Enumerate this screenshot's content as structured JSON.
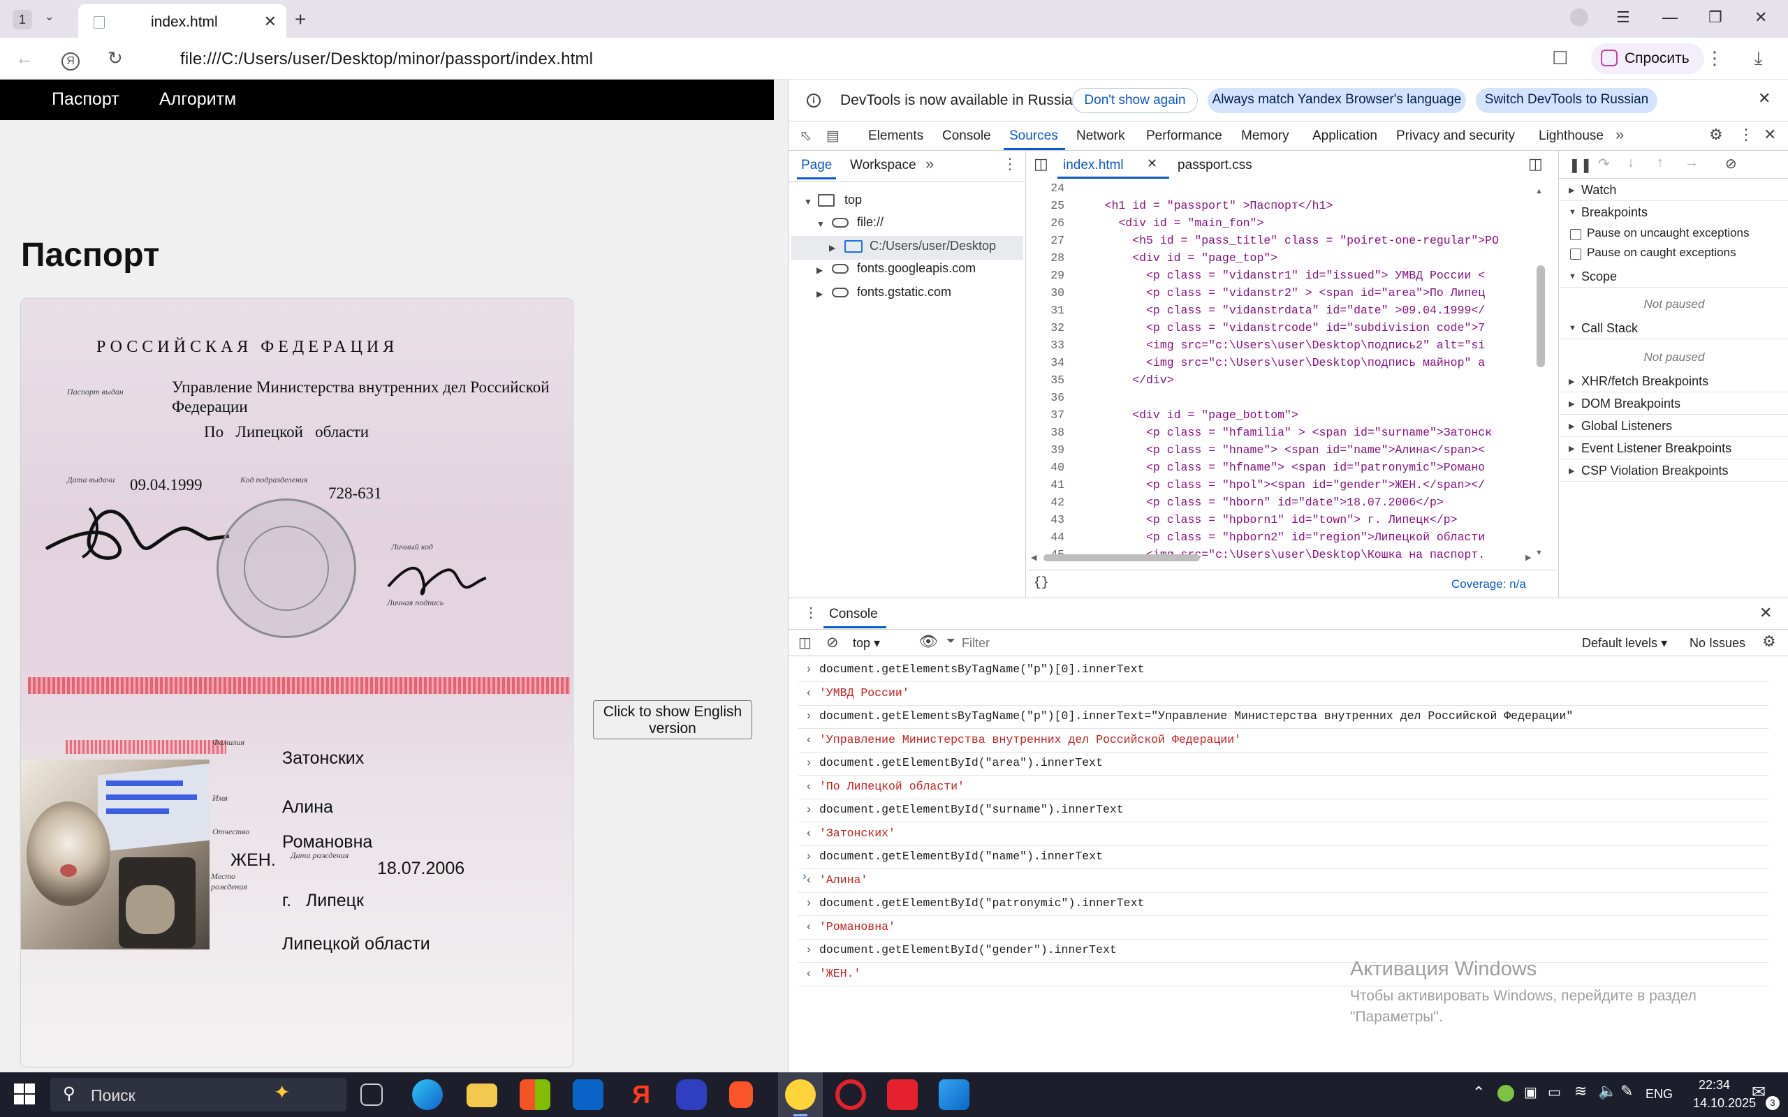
{
  "browser": {
    "tab_count": "1",
    "tab_title": "index.html",
    "url": "file:///C:/Users/user/Desktop/minor/passport/index.html",
    "ask_label": "Спросить"
  },
  "page": {
    "nav": [
      "Паспорт",
      "Алгоритм"
    ],
    "heading": "Паспорт",
    "passport": {
      "country": "РОССИЙСКАЯ   ФЕДЕРАЦИЯ",
      "issued_label": "Паспорт выдан",
      "issued_line1": "Управление Министерства внутренних дел Российской",
      "issued_line2": "Федерации",
      "area": "По   Липецкой   области",
      "date_label": "Дата выдачи",
      "date": "09.04.1999",
      "code_label": "Код подразделения",
      "code": "728-631",
      "personal_code_label": "Личный код",
      "personal_sign_label": "Личная подпись",
      "surname_label": "Фамилия",
      "surname": "Затонских",
      "name_label": "Имя",
      "name": "Алина",
      "patronymic_label": "Отчество",
      "patronymic": "Романовна",
      "gender": "ЖЕН.",
      "birth_label": "Дата рождения",
      "birth_date": "18.07.2006",
      "place_label": "Место рождения",
      "town": "г.   Липецк",
      "region": "Липецкой области"
    },
    "english_button": "Click to show English version"
  },
  "devtools": {
    "info": {
      "text": "DevTools is now available in Russian",
      "dont_show": "Don't show again",
      "match_language": "Always match Yandex Browser's language",
      "switch_russian": "Switch DevTools to Russian"
    },
    "tabs": [
      "Elements",
      "Console",
      "Sources",
      "Network",
      "Performance",
      "Memory",
      "Application",
      "Privacy and security",
      "Lighthouse"
    ],
    "active_tab": "Sources",
    "nav_subtabs": [
      "Page",
      "Workspace"
    ],
    "tree": [
      "top",
      "file://",
      "C:/Users/user/Desktop",
      "fonts.googleapis.com",
      "fonts.gstatic.com"
    ],
    "file_tabs": [
      "index.html",
      "passport.css"
    ],
    "code_lines": [
      {
        "n": "24",
        "code": ""
      },
      {
        "n": "25",
        "code": "    <h1 id = \"passport\" >Паспорт</h1>"
      },
      {
        "n": "26",
        "code": "      <div id = \"main_fon\">"
      },
      {
        "n": "27",
        "code": "        <h5 id = \"pass_title\" class = \"poiret-one-regular\">РО"
      },
      {
        "n": "28",
        "code": "        <div id = \"page_top\">"
      },
      {
        "n": "29",
        "code": "          <p class = \"vidanstr1\" id=\"issued\"> УМВД России <"
      },
      {
        "n": "30",
        "code": "          <p class = \"vidanstr2\" > <span id=\"area\">По Липец"
      },
      {
        "n": "31",
        "code": "          <p class = \"vidanstrdata\" id=\"date\" >09.04.1999</"
      },
      {
        "n": "32",
        "code": "          <p class = \"vidanstrcode\" id=\"subdivision code\">7"
      },
      {
        "n": "33",
        "code": "          <img src=\"c:\\Users\\user\\Desktop\\подпись2\" alt=\"si"
      },
      {
        "n": "34",
        "code": "          <img src=\"c:\\Users\\user\\Desktop\\подпись майнор\" a"
      },
      {
        "n": "35",
        "code": "        </div>"
      },
      {
        "n": "36",
        "code": ""
      },
      {
        "n": "37",
        "code": "        <div id = \"page_bottom\">"
      },
      {
        "n": "38",
        "code": "          <p class = \"hfamilia\" > <span id=\"surname\">Затонск"
      },
      {
        "n": "39",
        "code": "          <p class = \"hname\"> <span id=\"name\">Алина</span><"
      },
      {
        "n": "40",
        "code": "          <p class = \"hfname\"> <span id=\"patronymic\">Романо"
      },
      {
        "n": "41",
        "code": "          <p class = \"hpol\"><span id=\"gender\">ЖЕН.</span></"
      },
      {
        "n": "42",
        "code": "          <p class = \"hborn\" id=\"date\">18.07.2006</p>"
      },
      {
        "n": "43",
        "code": "          <p class = \"hpborn1\" id=\"town\"> г. Липецк</p>"
      },
      {
        "n": "44",
        "code": "          <p class = \"hpborn2\" id=\"region\">Липецкой области"
      },
      {
        "n": "45",
        "code": "          <img src=\"c:\\Users\\user\\Desktop\\Кошка на паспорт."
      }
    ],
    "coverage": "Coverage: n/a",
    "format_label": "{}",
    "debugger": {
      "watch": "Watch",
      "breakpoints": "Breakpoints",
      "pause_uncaught": "Pause on uncaught exceptions",
      "pause_caught": "Pause on caught exceptions",
      "scope": "Scope",
      "not_paused": "Not paused",
      "call_stack": "Call Stack",
      "sections": [
        "XHR/fetch Breakpoints",
        "DOM Breakpoints",
        "Global Listeners",
        "Event Listener Breakpoints",
        "CSP Violation Breakpoints"
      ]
    },
    "console": {
      "title": "Console",
      "context": "top",
      "filter_placeholder": "Filter",
      "levels": "Default levels",
      "issues": "No Issues",
      "rows": [
        {
          "kind": "in",
          "text": "document.getElementsByTagName(\"p\")[0].innerText"
        },
        {
          "kind": "out",
          "text": "'УМВД России'"
        },
        {
          "kind": "in",
          "text": "document.getElementsByTagName(\"p\")[0].innerText=\"Управление Министерства внутренних дел Российской Федерации\""
        },
        {
          "kind": "out",
          "text": "'Управление Министерства внутренних дел Российской Федерации'"
        },
        {
          "kind": "in",
          "text": "document.getElementById(\"area\").innerText"
        },
        {
          "kind": "out",
          "text": "'По Липецкой области'"
        },
        {
          "kind": "in",
          "text": "document.getElementById(\"surname\").innerText"
        },
        {
          "kind": "out",
          "text": "'Затонских'"
        },
        {
          "kind": "in",
          "text": "document.getElementById(\"name\").innerText"
        },
        {
          "kind": "out",
          "text": "'Алина'"
        },
        {
          "kind": "in",
          "text": "document.getElementById(\"patronymic\").innerText"
        },
        {
          "kind": "out",
          "text": "'Романовна'"
        },
        {
          "kind": "in",
          "text": "document.getElementById(\"gender\").innerText"
        },
        {
          "kind": "out",
          "text": "'ЖЕН.'"
        }
      ]
    }
  },
  "watermark": {
    "title": "Активация Windows",
    "subtitle": "Чтобы активировать Windows, перейдите в раздел \"Параметры\"."
  },
  "taskbar": {
    "search": "Поиск",
    "lang": "ENG",
    "time": "22:34",
    "date": "14.10.2025",
    "notifications": "3"
  }
}
